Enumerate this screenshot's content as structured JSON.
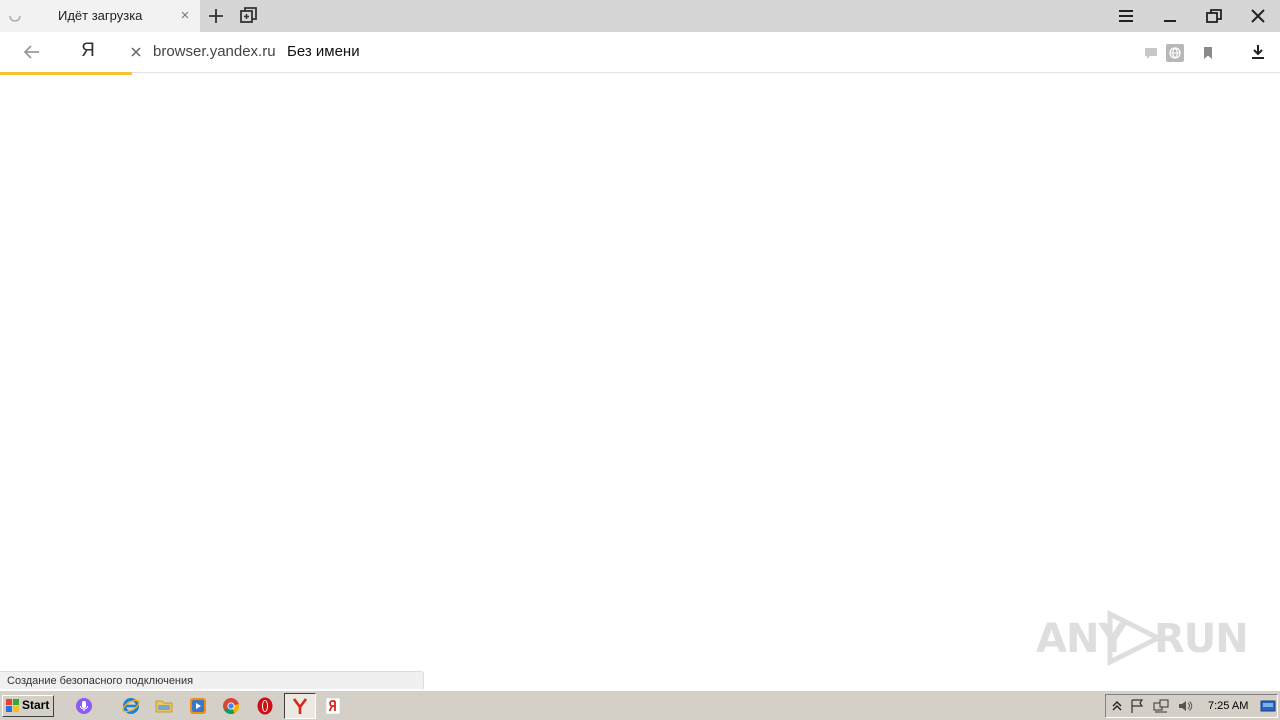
{
  "browser": {
    "tab": {
      "title": "Идёт загрузка",
      "close_glyph": "×",
      "spinner_icon": "loading-spinner-icon"
    },
    "tab_actions": {
      "new_tab_icon": "plus-icon",
      "tabs_manager_icon": "tabs-icon"
    },
    "window_controls": {
      "menu_icon": "hamburger-icon",
      "minimize_icon": "minimize-icon",
      "restore_icon": "restore-icon",
      "close_icon": "close-icon"
    },
    "nav": {
      "back_icon": "back-arrow-icon",
      "logo": "Я"
    },
    "omnibox": {
      "stop_icon": "stop-icon",
      "host": "browser.yandex.ru",
      "page_title": "Без имени",
      "icons": [
        "comment-icon",
        "translate-icon",
        "bookmark-icon"
      ]
    },
    "downloads_icon": "download-icon",
    "load_progress": 0.103,
    "accent_color": "#f4c430"
  },
  "page": {
    "status_text": "Создание безопасного подключения",
    "watermark": {
      "left": "ANY",
      "right": "RUN"
    }
  },
  "taskbar": {
    "start_label": "Start",
    "apps": [
      "alice-voice-icon",
      "internet-explorer-icon",
      "file-explorer-icon",
      "media-player-icon",
      "chrome-icon",
      "opera-icon",
      "yandex-browser-icon",
      "yandex-icon"
    ],
    "tray_icons": [
      "show-hidden-icon",
      "flag-icon",
      "network-icon",
      "volume-icon",
      "desktop-icon"
    ],
    "clock": "7:25 AM"
  }
}
